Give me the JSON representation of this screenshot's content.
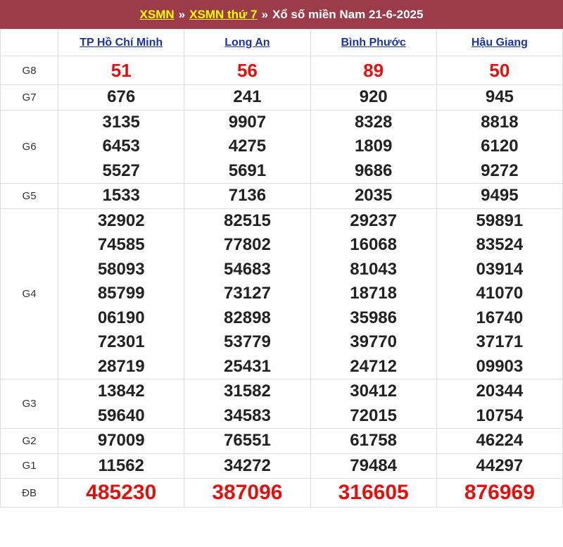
{
  "header": {
    "link1": "XSMN",
    "sep1": "»",
    "link2": "XSMN thứ 7",
    "sep2": "»",
    "title": "Xổ số miền Nam 21-6-2025"
  },
  "provinces": [
    "TP Hồ Chí Minh",
    "Long An",
    "Bình Phước",
    "Hậu Giang"
  ],
  "prizes": [
    {
      "label": "G8",
      "values": [
        [
          "51"
        ],
        [
          "56"
        ],
        [
          "89"
        ],
        [
          "50"
        ]
      ]
    },
    {
      "label": "G7",
      "values": [
        [
          "676"
        ],
        [
          "241"
        ],
        [
          "920"
        ],
        [
          "945"
        ]
      ]
    },
    {
      "label": "G6",
      "values": [
        [
          "3135",
          "6453",
          "5527"
        ],
        [
          "9907",
          "4275",
          "5691"
        ],
        [
          "8328",
          "1809",
          "9686"
        ],
        [
          "8818",
          "6120",
          "9272"
        ]
      ]
    },
    {
      "label": "G5",
      "values": [
        [
          "1533"
        ],
        [
          "7136"
        ],
        [
          "2035"
        ],
        [
          "9495"
        ]
      ]
    },
    {
      "label": "G4",
      "values": [
        [
          "32902",
          "74585",
          "58093",
          "85799",
          "06190",
          "72301",
          "28719"
        ],
        [
          "82515",
          "77802",
          "54683",
          "73127",
          "82898",
          "53779",
          "25431"
        ],
        [
          "29237",
          "16068",
          "81043",
          "18718",
          "35986",
          "39770",
          "24712"
        ],
        [
          "59891",
          "83524",
          "03914",
          "41070",
          "16740",
          "37171",
          "09903"
        ]
      ]
    },
    {
      "label": "G3",
      "values": [
        [
          "13842",
          "59640"
        ],
        [
          "31582",
          "34583"
        ],
        [
          "30412",
          "72015"
        ],
        [
          "20344",
          "10754"
        ]
      ]
    },
    {
      "label": "G2",
      "values": [
        [
          "97009"
        ],
        [
          "76551"
        ],
        [
          "61758"
        ],
        [
          "46224"
        ]
      ]
    },
    {
      "label": "G1",
      "values": [
        [
          "11562"
        ],
        [
          "34272"
        ],
        [
          "79484"
        ],
        [
          "44297"
        ]
      ]
    },
    {
      "label": "ĐB",
      "values": [
        [
          "485230"
        ],
        [
          "387096"
        ],
        [
          "316605"
        ],
        [
          "876969"
        ]
      ]
    }
  ],
  "colors": {
    "header_bg": "#9c3c4a",
    "header_link": "#ffff00",
    "special_number": "#e41010",
    "province_link": "#1a33a8"
  }
}
